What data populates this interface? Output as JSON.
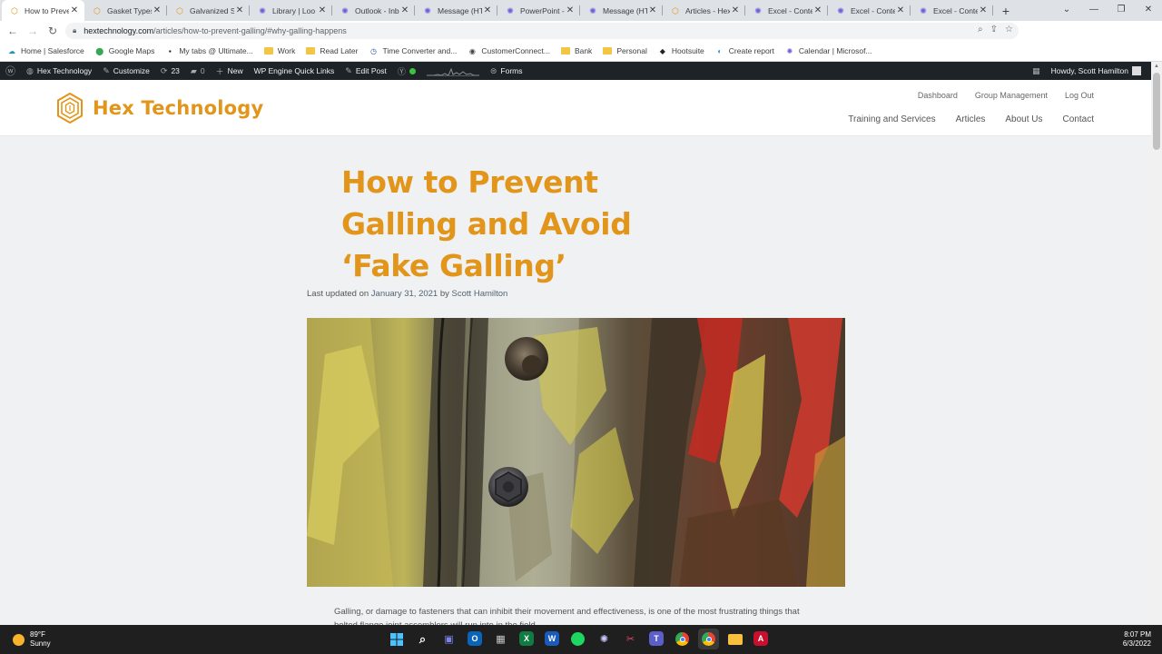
{
  "tabs": [
    {
      "label": "How to Preve",
      "favicon": "hex-logo-icon",
      "active": true
    },
    {
      "label": "Gasket Types",
      "favicon": "hex-logo-icon"
    },
    {
      "label": "Galvanized St",
      "favicon": "hex-logo-icon"
    },
    {
      "label": "Library | Loo",
      "favicon": "gear-icon"
    },
    {
      "label": "Outlook - Inb",
      "favicon": "gear-icon"
    },
    {
      "label": "Message (HT",
      "favicon": "gear-icon"
    },
    {
      "label": "PowerPoint -",
      "favicon": "gear-icon"
    },
    {
      "label": "Message (HT",
      "favicon": "gear-icon"
    },
    {
      "label": "Articles - Hex",
      "favicon": "hex-logo-icon"
    },
    {
      "label": "Excel - Conte",
      "favicon": "gear-icon"
    },
    {
      "label": "Excel - Conte",
      "favicon": "gear-icon"
    },
    {
      "label": "Excel - Conte",
      "favicon": "gear-icon"
    }
  ],
  "address": {
    "host": "hextechnology.com",
    "path": "/articles/how-to-prevent-galling/#why-galling-happens"
  },
  "bookmarks": [
    {
      "label": "Home | Salesforce",
      "icon": "cloud-icon"
    },
    {
      "label": "Google Maps",
      "icon": "map-pin-icon"
    },
    {
      "label": "My tabs @ Ultimate...",
      "icon": "guitar-icon"
    },
    {
      "label": "Work",
      "icon": "folder-icon"
    },
    {
      "label": "Read Later",
      "icon": "folder-icon"
    },
    {
      "label": "Time Converter and...",
      "icon": "clock-icon"
    },
    {
      "label": "CustomerConnect...",
      "icon": "globe-icon"
    },
    {
      "label": "Bank",
      "icon": "folder-icon"
    },
    {
      "label": "Personal",
      "icon": "folder-icon"
    },
    {
      "label": "Hootsuite",
      "icon": "owl-icon"
    },
    {
      "label": "Create report",
      "icon": "report-icon"
    },
    {
      "label": "Calendar | Microsof...",
      "icon": "gear-icon"
    }
  ],
  "wpbar": {
    "site": "Hex Technology",
    "customize": "Customize",
    "updates": "23",
    "comments": "0",
    "new": "New",
    "quicklinks": "WP Engine Quick Links",
    "edit": "Edit Post",
    "forms": "Forms",
    "howdy": "Howdy, Scott Hamilton"
  },
  "site": {
    "name": "Hex Technology",
    "top_nav": [
      "Dashboard",
      "Group Management",
      "Log Out"
    ],
    "main_nav": [
      "Training and Services",
      "Articles",
      "About Us",
      "Contact"
    ]
  },
  "article": {
    "title": "How to Prevent Galling and Avoid ‘Fake Galling’",
    "meta_prefix": "Last updated on",
    "date": "January 31, 2021",
    "by": "by",
    "author": "Scott Hamilton",
    "paragraph": "Galling, or damage to fasteners that can inhibit their movement and effectiveness, is one of the most frustrating things that bolted flange joint assemblers will run into in the field."
  },
  "taskbar": {
    "temp": "89°F",
    "condition": "Sunny",
    "time": "8:07 PM",
    "date": "6/3/2022"
  },
  "colors": {
    "brand": "#e2951b",
    "wpbar": "#1d2327"
  }
}
